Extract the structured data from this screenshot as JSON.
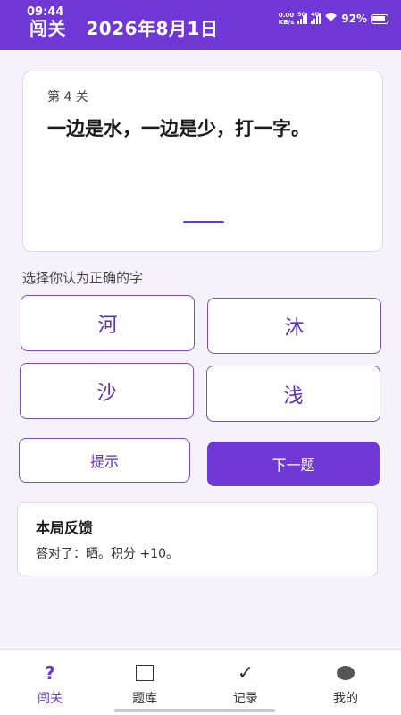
{
  "status_bar": {
    "time": "09:44",
    "net_speed_value": "0.00",
    "net_speed_unit": "KB/s",
    "signal1": "5G",
    "signal2": "4G",
    "battery": "92%"
  },
  "header": {
    "app_name": "闯关",
    "date": "2026年8月1日",
    "accent_color": "#6f37d6"
  },
  "question": {
    "level": "第 4 关",
    "text": "一边是水，一边是少，打一字。"
  },
  "prompt": "选择你认为正确的字",
  "choices": [
    "河",
    "沐",
    "沙",
    "浅"
  ],
  "actions": {
    "hint_label": "提示",
    "next_label": "下一题"
  },
  "feedback": {
    "title": "本局反馈",
    "text": "答对了：晒。积分 +10。"
  },
  "nav": {
    "items": [
      {
        "label": "闯关",
        "icon": "question-icon",
        "glyph": "?"
      },
      {
        "label": "题库",
        "icon": "square-icon"
      },
      {
        "label": "记录",
        "icon": "check-icon",
        "glyph": "✓"
      },
      {
        "label": "我的",
        "icon": "circle-icon"
      }
    ]
  }
}
